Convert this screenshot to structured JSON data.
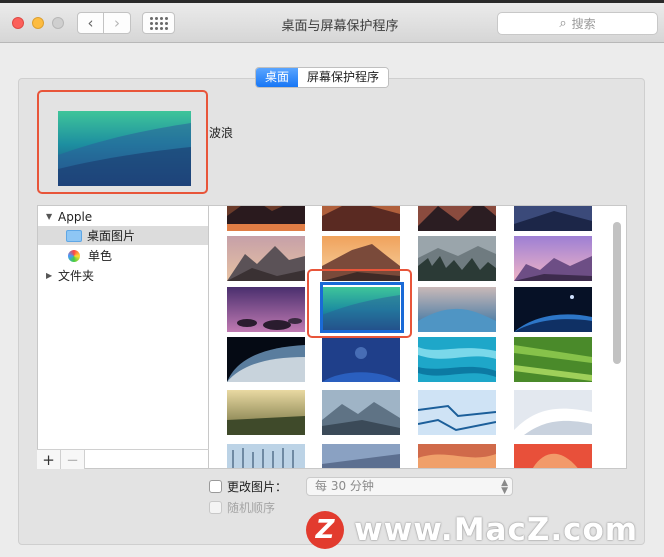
{
  "window": {
    "title": "桌面与屏幕保护程序",
    "search_placeholder": "搜索"
  },
  "tabs": [
    {
      "label": "桌面",
      "active": true
    },
    {
      "label": "屏幕保护程序",
      "active": false
    }
  ],
  "preview": {
    "name": "波浪"
  },
  "sidebar": {
    "items": [
      {
        "label": "Apple",
        "expanded": true
      },
      {
        "label": "桌面图片",
        "selected": true
      },
      {
        "label": "单色"
      },
      {
        "label": "文件夹",
        "expanded": false
      }
    ],
    "add_label": "+",
    "remove_label": "−"
  },
  "options": {
    "change_picture_label": "更改图片：",
    "interval_value": "每 30 分钟",
    "random_label": "随机顺序"
  },
  "watermark": {
    "logo": "Z",
    "text": "www.MacZ.com"
  },
  "colors": {
    "accent": "#1776f5",
    "highlight": "#e8553a",
    "selection": "#1a6ad7"
  }
}
